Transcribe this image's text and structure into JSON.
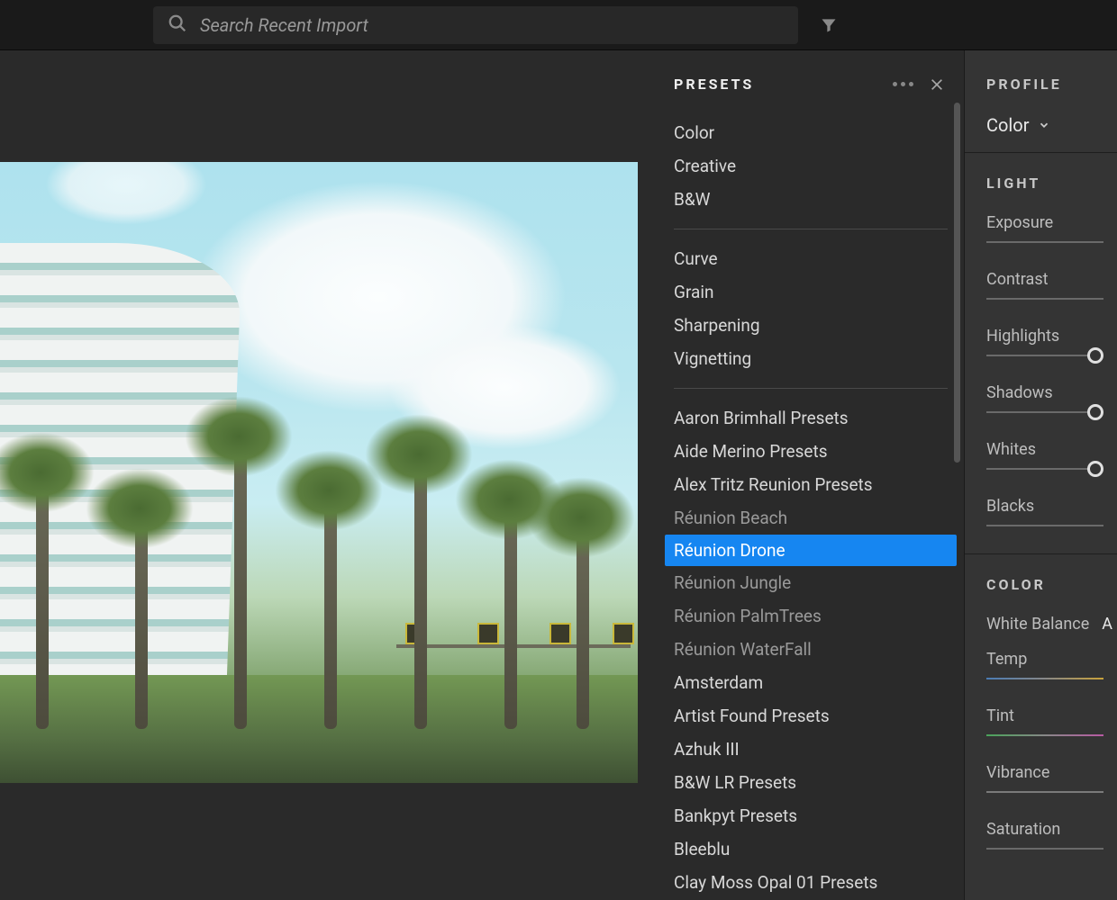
{
  "topbar": {
    "search_placeholder": "Search Recent Import"
  },
  "presets": {
    "title": "PRESETS",
    "groups": {
      "basic": [
        "Color",
        "Creative",
        "B&W"
      ],
      "adjust": [
        "Curve",
        "Grain",
        "Sharpening",
        "Vignetting"
      ],
      "user": [
        {
          "label": "Aaron Brimhall Presets",
          "dim": false
        },
        {
          "label": "Aide Merino Presets",
          "dim": false
        },
        {
          "label": "Alex Tritz Reunion Presets",
          "dim": false
        },
        {
          "label": "Réunion Beach",
          "dim": true
        },
        {
          "label": "Réunion Drone",
          "dim": false,
          "selected": true
        },
        {
          "label": "Réunion Jungle",
          "dim": true
        },
        {
          "label": "Réunion PalmTrees",
          "dim": true
        },
        {
          "label": "Réunion WaterFall",
          "dim": true
        },
        {
          "label": "Amsterdam",
          "dim": false
        },
        {
          "label": "Artist Found Presets",
          "dim": false
        },
        {
          "label": "Azhuk III",
          "dim": false
        },
        {
          "label": "B&W LR Presets",
          "dim": false
        },
        {
          "label": "Bankpyt Presets",
          "dim": false
        },
        {
          "label": "Bleeblu",
          "dim": false
        },
        {
          "label": "Clay Moss Opal 01 Presets",
          "dim": false
        }
      ]
    }
  },
  "edit": {
    "profile": {
      "title": "PROFILE",
      "value": "Color"
    },
    "light": {
      "title": "LIGHT",
      "sliders": [
        "Exposure",
        "Contrast",
        "Highlights",
        "Shadows",
        "Whites",
        "Blacks"
      ]
    },
    "color": {
      "title": "COLOR",
      "wb_label": "White Balance",
      "wb_value": "A",
      "sliders": [
        "Temp",
        "Tint",
        "Vibrance",
        "Saturation"
      ]
    }
  }
}
